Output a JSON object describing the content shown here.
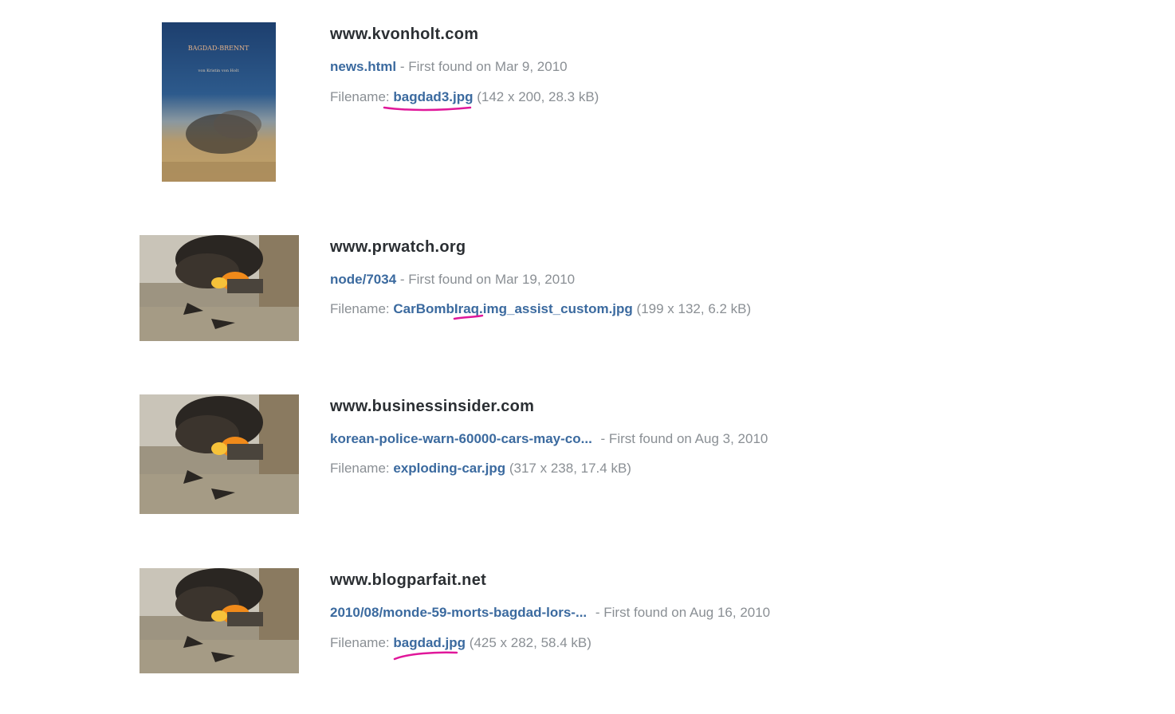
{
  "results": [
    {
      "domain": "www.kvonholt.com",
      "page_link": "news.html",
      "first_found": "- First found on Mar 9, 2010",
      "filename_label": "Filename:",
      "filename": "bagdad3.jpg",
      "file_meta": "(142 x 200, 28.3 kB)",
      "thumb_text": [
        "BAGDAD-BRENNT",
        "von Kristin von Holt"
      ]
    },
    {
      "domain": "www.prwatch.org",
      "page_link": "node/7034",
      "first_found": "- First found on Mar 19, 2010",
      "filename_label": "Filename:",
      "filename": "CarBombIraq.img_assist_custom.jpg",
      "file_meta": "(199 x 132, 6.2 kB)"
    },
    {
      "domain": "www.businessinsider.com",
      "page_link": "korean-police-warn-60000-cars-may-co...",
      "first_found": "- First found on Aug 3, 2010",
      "filename_label": "Filename:",
      "filename": "exploding-car.jpg",
      "file_meta": "(317 x 238, 17.4 kB)"
    },
    {
      "domain": "www.blogparfait.net",
      "page_link": "2010/08/monde-59-morts-bagdad-lors-...",
      "first_found": "- First found on Aug 16, 2010",
      "filename_label": "Filename:",
      "filename": "bagdad.jpg",
      "file_meta": "(425 x 282, 58.4 kB)"
    }
  ],
  "colors": {
    "link": "#3b6a9f",
    "domain": "#2b2f33",
    "muted": "#8a8f94",
    "annotation": "#e0179a"
  }
}
